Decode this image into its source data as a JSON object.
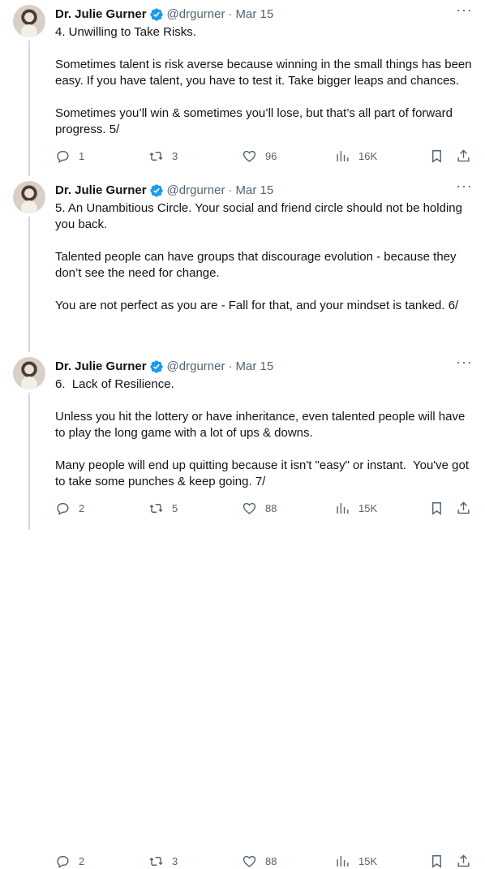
{
  "tweets": [
    {
      "author": {
        "name": "Dr. Julie Gurner",
        "handle": "@drgurner"
      },
      "separator": "·",
      "date": "Mar 15",
      "more_icon": "more-horizontal-icon",
      "text": "4. Unwilling to Take Risks.\n\nSometimes talent is risk averse because winning in the small things has been easy. If you have talent, you have to test it. Take bigger leaps and chances.\n\nSometimes you’ll win & sometimes you’ll lose, but that’s all part of forward progress. 5/",
      "stats": {
        "replies": "1",
        "retweets": "3",
        "likes": "96",
        "views": "16K"
      }
    },
    {
      "author": {
        "name": "Dr. Julie Gurner",
        "handle": "@drgurner"
      },
      "separator": "·",
      "date": "Mar 15",
      "more_icon": "more-horizontal-icon",
      "text": "5. An Unambitious Circle. Your social and friend circle should not be holding you back.\n\nTalented people can have groups that discourage evolution - because they don’t see the need for change.\n\nYou are not perfect as you are - Fall for that, and your mindset is tanked. 6/",
      "stats": {
        "replies": "2",
        "retweets": "5",
        "likes": "88",
        "views": "15K"
      }
    },
    {
      "author": {
        "name": "Dr. Julie Gurner",
        "handle": "@drgurner"
      },
      "separator": "·",
      "date": "Mar 15",
      "more_icon": "more-horizontal-icon",
      "text": "6.  Lack of Resilience.\n\nUnless you hit the lottery or have inheritance, even talented people will have to play the long game with a lot of ups & downs.\n\nMany people will end up quitting because it isn't \"easy\" or instant.  You've got to take some punches & keep going. 7/",
      "stats": {
        "replies": "2",
        "retweets": "3",
        "likes": "88",
        "views": "15K"
      }
    }
  ],
  "colors": {
    "text": "#0f1419",
    "muted": "#536471",
    "verified": "#1d9bf0",
    "thread_line": "#cfd9de"
  }
}
